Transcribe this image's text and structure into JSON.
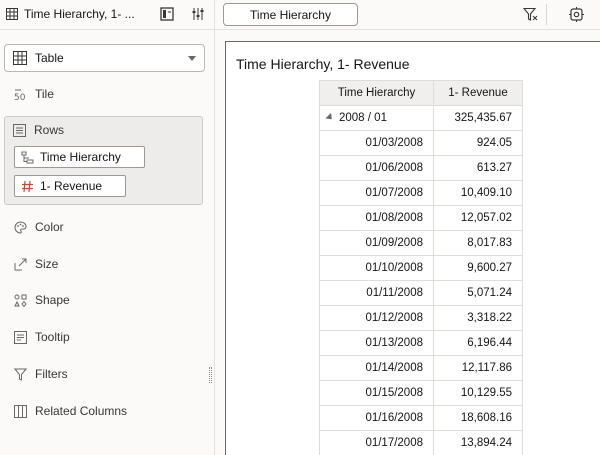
{
  "left_panel": {
    "title": "Time Hierarchy, 1- ...",
    "viz_type": "Table",
    "grammar": {
      "tile": "Tile",
      "rows": "Rows",
      "color": "Color",
      "size": "Size",
      "shape": "Shape",
      "tooltip": "Tooltip",
      "filters": "Filters",
      "related_columns": "Related Columns"
    },
    "rows_items": [
      "Time Hierarchy",
      "1- Revenue"
    ]
  },
  "toolbar": {
    "tab_label": "Time Hierarchy"
  },
  "visualization": {
    "title": "Time Hierarchy, 1- Revenue",
    "columns": [
      "Time Hierarchy",
      "1- Revenue"
    ],
    "group_row": {
      "label": "2008 / 01",
      "value": "325,435.67"
    },
    "rows": [
      {
        "date": "01/03/2008",
        "revenue": "924.05"
      },
      {
        "date": "01/06/2008",
        "revenue": "613.27"
      },
      {
        "date": "01/07/2008",
        "revenue": "10,409.10"
      },
      {
        "date": "01/08/2008",
        "revenue": "12,057.02"
      },
      {
        "date": "01/09/2008",
        "revenue": "8,017.83"
      },
      {
        "date": "01/10/2008",
        "revenue": "9,600.27"
      },
      {
        "date": "01/11/2008",
        "revenue": "5,071.24"
      },
      {
        "date": "01/12/2008",
        "revenue": "3,318.22"
      },
      {
        "date": "01/13/2008",
        "revenue": "6,196.44"
      },
      {
        "date": "01/14/2008",
        "revenue": "12,117.86"
      },
      {
        "date": "01/15/2008",
        "revenue": "10,129.55"
      },
      {
        "date": "01/16/2008",
        "revenue": "18,608.16"
      },
      {
        "date": "01/17/2008",
        "revenue": "13,894.24"
      }
    ]
  },
  "colors": {
    "accent": "#227e9e",
    "pill_hash": "#c74634"
  },
  "icons": {
    "title": "table-icon",
    "grammar_tab": "grammar-icon",
    "properties_tab": "properties-sliders-icon",
    "viz_type": "table-icon",
    "tile": "tile-50-icon",
    "rows": "rows-icon",
    "hierarchy": "hierarchy-icon",
    "measure": "hash-icon",
    "color": "palette-icon",
    "size": "size-icon",
    "shape": "shape-icon",
    "tooltip": "tooltip-icon",
    "filters": "filter-icon",
    "related": "columns-icon",
    "filter_toolbar": "filter-x-icon",
    "settings_toolbar": "gear-icon"
  }
}
